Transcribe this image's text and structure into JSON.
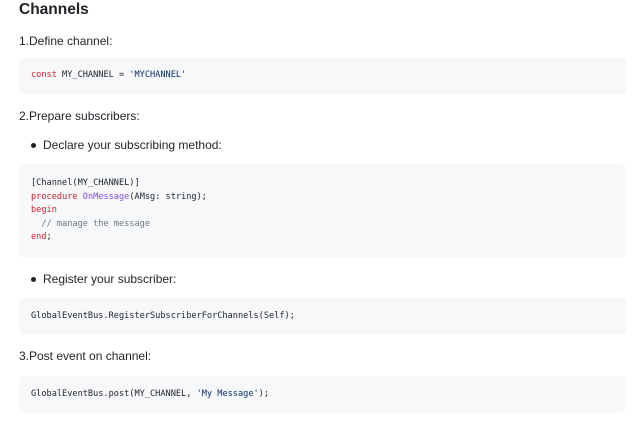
{
  "heading": "Channels",
  "steps": {
    "define": "1.Define channel:",
    "prepare": "2.Prepare subscribers:",
    "post": "3.Post event on channel:"
  },
  "bullets": {
    "declare": "Declare your subscribing method:",
    "register": "Register your subscriber:"
  },
  "code": {
    "define": {
      "kw_const": "const",
      "name": " MY_CHANNEL = ",
      "value": "'MYCHANNEL'"
    },
    "declare": {
      "line1": "[Channel(MY_CHANNEL)]",
      "kw_procedure": "procedure",
      "method": "OnMessage",
      "params": "(AMsg: string);",
      "kw_begin": "begin",
      "comment": "  // manage the message",
      "kw_end": "end",
      "end_semi": ";"
    },
    "register": "GlobalEventBus.RegisterSubscriberForChannels(Self);",
    "post": {
      "prefix": "GlobalEventBus.post(MY_CHANNEL, ",
      "value": "'My Message'",
      "suffix": ");"
    }
  },
  "colors": {
    "code_background": "#f6f8fa",
    "keyword": "#cf222e",
    "function": "#8250df",
    "string": "#0a3069",
    "comment": "#6e7781"
  }
}
